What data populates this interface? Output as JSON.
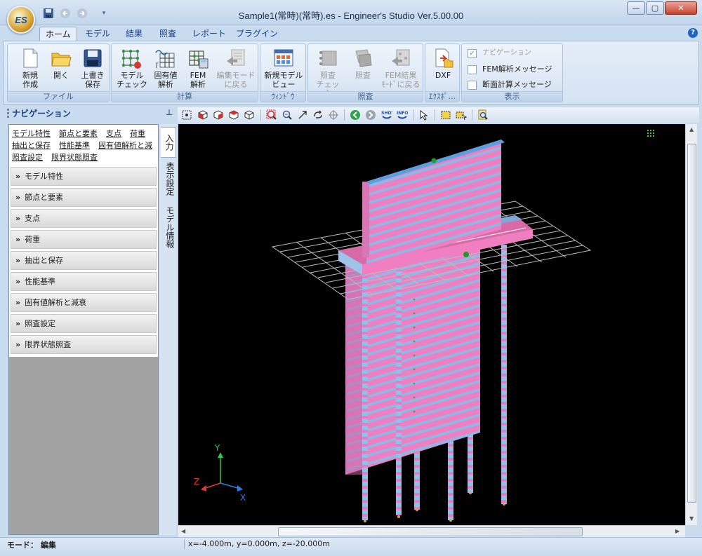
{
  "window": {
    "title": "Sample1(常時)(常時).es - Engineer's Studio Ver.5.00.00",
    "orb_label": "ES",
    "controls": {
      "minimize": "—",
      "maximize": "▢",
      "close": "✕"
    }
  },
  "ribbon": {
    "tabs": [
      "ホーム",
      "モデル",
      "結果",
      "照査",
      "レポート",
      "プラグイン"
    ],
    "active_tab": "ホーム",
    "groups": {
      "file": {
        "label": "ファイル",
        "buttons": [
          "新規\n作成",
          "開く",
          "上書き\n保存"
        ]
      },
      "calc": {
        "label": "計算",
        "buttons": [
          "モデル\nチェック",
          "固有値\n解析",
          "FEM\n解析",
          "編集モード\nに戻る"
        ]
      },
      "window": {
        "label": "ｳｨﾝﾄﾞｳ",
        "buttons": [
          "新規モデル\nビュー"
        ]
      },
      "check": {
        "label": "照査",
        "buttons": [
          "照査\nチェック",
          "照査",
          "FEM結果\nﾓｰﾄﾞに戻る"
        ]
      },
      "export": {
        "label": "ｴｸｽﾎﾟ...",
        "buttons": [
          "DXF"
        ]
      },
      "display": {
        "label": "表示",
        "checks": [
          {
            "label": "ナビゲーション",
            "checked": true,
            "disabled": true
          },
          {
            "label": "FEM解析メッセージ",
            "checked": false,
            "disabled": false
          },
          {
            "label": "断面計算メッセージ",
            "checked": false,
            "disabled": false
          }
        ]
      }
    }
  },
  "navigation": {
    "title": "ナビゲーション",
    "links": [
      "モデル特性",
      "節点と要素",
      "支点",
      "荷重",
      "抽出と保存",
      "性能基準",
      "固有値解析と減",
      "照査設定",
      "限界状態照査"
    ],
    "sections": [
      "モデル特性",
      "節点と要素",
      "支点",
      "荷重",
      "抽出と保存",
      "性能基準",
      "固有値解析と減衰",
      "照査設定",
      "限界状態照査"
    ],
    "side_tabs": [
      "入力",
      "表示設定",
      "モデル情報"
    ]
  },
  "viewport": {
    "axes": {
      "x": "X",
      "y": "Y",
      "z": "Z"
    },
    "colors": {
      "pink": "#ef7fc0",
      "blue": "#7fb3e8",
      "grid": "#bfbfbf"
    }
  },
  "status": {
    "mode": "モード： 編集",
    "coords": "x=-4.000m, y=0.000m, z=-20.000m"
  }
}
